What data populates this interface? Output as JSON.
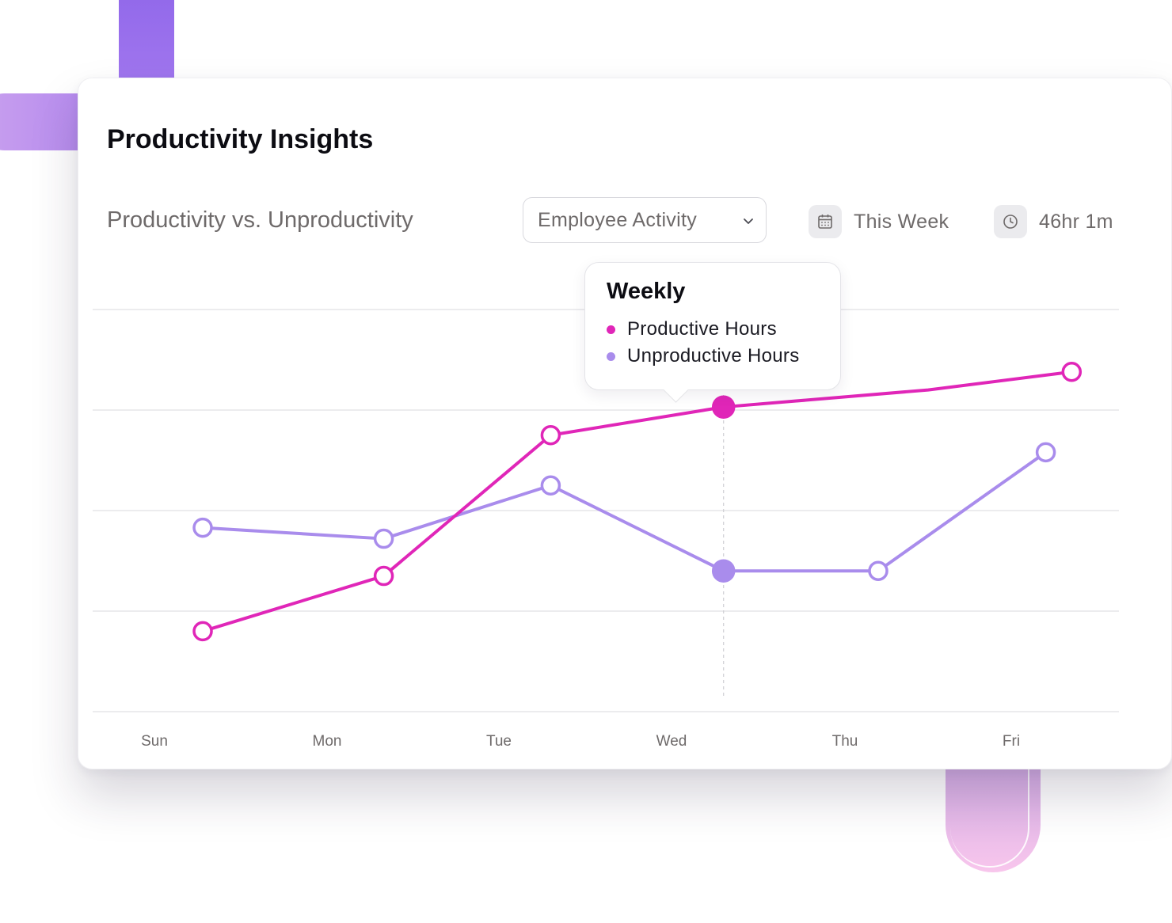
{
  "card": {
    "title": "Productivity Insights",
    "subtitle": "Productivity vs. Unproductivity"
  },
  "filter": {
    "dropdown_label": "Employee Activity",
    "period_label": "This Week",
    "duration_label": "46hr 1m"
  },
  "tooltip": {
    "title": "Weekly",
    "items": [
      {
        "label": "Productive Hours",
        "color": "#e026b8"
      },
      {
        "label": "Unproductive Hours",
        "color": "#a98cec"
      }
    ]
  },
  "colors": {
    "productive": "#e026b8",
    "unproductive": "#a98cec",
    "grid": "#e6e6e9",
    "axis_text": "#6e6a6a"
  },
  "chart_data": {
    "type": "line",
    "categories": [
      "Sun",
      "Mon",
      "Tue",
      "Wed",
      "Thu",
      "Fri"
    ],
    "ylim": [
      0,
      4
    ],
    "grid": true,
    "highlighted_category": "Wed",
    "series": [
      {
        "name": "Productive Hours",
        "points": [
          {
            "x": 0.28,
            "y": 0.8
          },
          {
            "x": 1.33,
            "y": 1.35
          },
          {
            "x": 2.3,
            "y": 2.75
          },
          {
            "x": 3.3,
            "y": 3.03
          },
          {
            "x": 4.5,
            "y": 3.2
          },
          {
            "x": 5.35,
            "y": 3.38
          }
        ]
      },
      {
        "name": "Unproductive Hours",
        "points": [
          {
            "x": 0.28,
            "y": 1.83
          },
          {
            "x": 1.33,
            "y": 1.72
          },
          {
            "x": 2.3,
            "y": 2.25
          },
          {
            "x": 3.3,
            "y": 1.4
          },
          {
            "x": 4.2,
            "y": 1.4
          },
          {
            "x": 5.2,
            "y": 2.58
          }
        ]
      }
    ]
  }
}
